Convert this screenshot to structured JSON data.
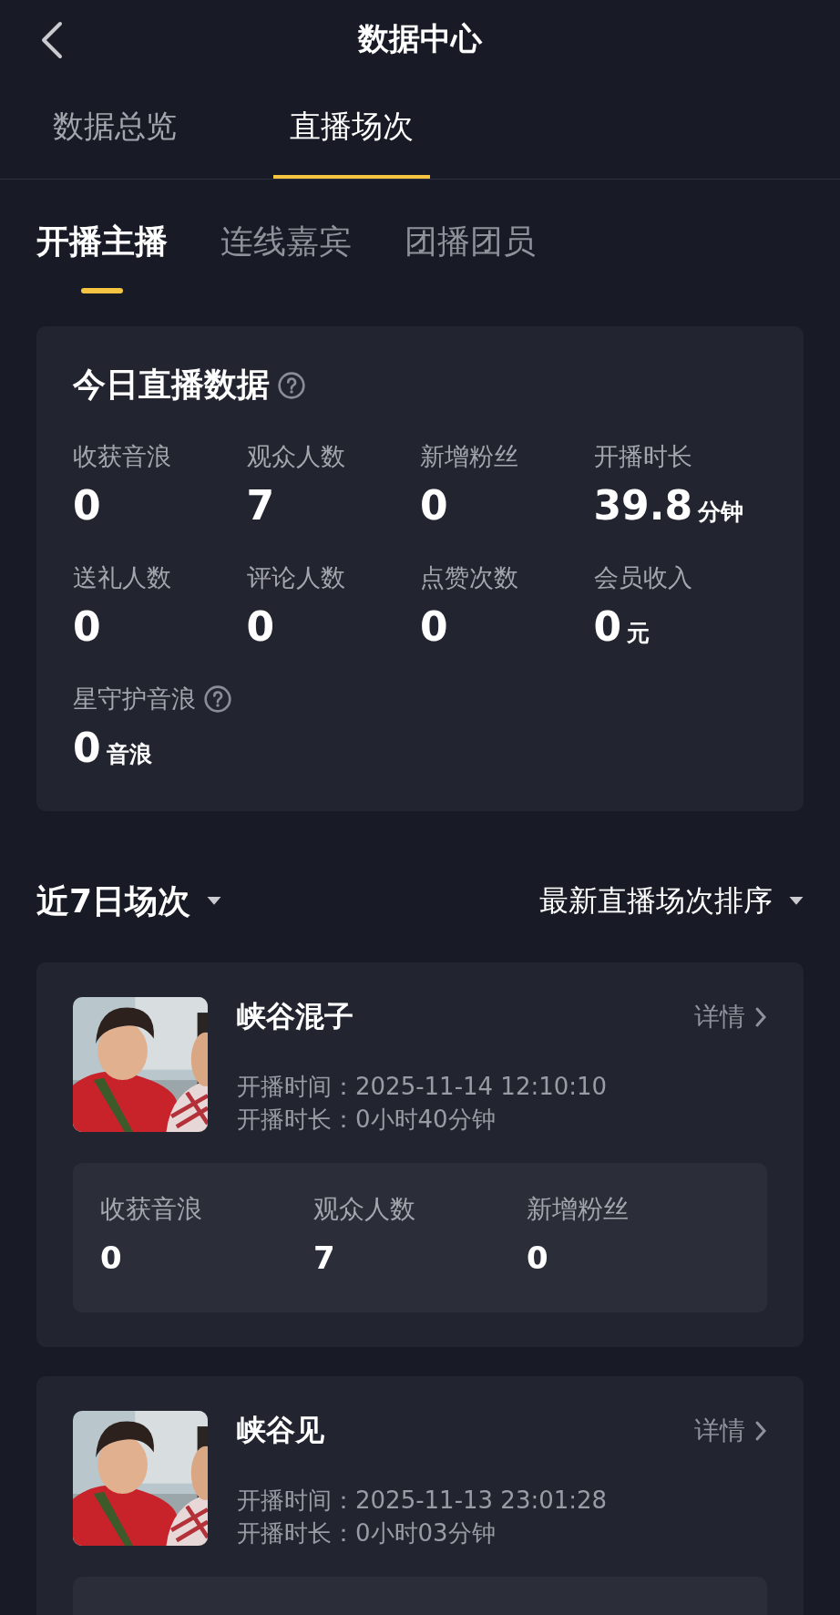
{
  "header": {
    "title": "数据中心"
  },
  "tabs": [
    {
      "label": "数据总览",
      "selected": false
    },
    {
      "label": "直播场次",
      "selected": true
    }
  ],
  "sub_tabs": [
    {
      "label": "开播主播",
      "selected": true
    },
    {
      "label": "连线嘉宾",
      "selected": false
    },
    {
      "label": "团播团员",
      "selected": false
    }
  ],
  "today": {
    "title": "今日直播数据",
    "help": true,
    "stats": [
      {
        "label": "收获音浪",
        "value": "0",
        "help": false
      },
      {
        "label": "观众人数",
        "value": "7",
        "help": false
      },
      {
        "label": "新增粉丝",
        "value": "0",
        "help": false
      },
      {
        "label": "开播时长",
        "value": "39.8",
        "unit": "分钟",
        "help": false
      },
      {
        "label": "送礼人数",
        "value": "0",
        "help": false
      },
      {
        "label": "评论人数",
        "value": "0",
        "help": false
      },
      {
        "label": "点赞次数",
        "value": "0",
        "help": false
      },
      {
        "label": "会员收入",
        "value": "0",
        "unit": "元",
        "help": false
      },
      {
        "label": "星守护音浪",
        "value": "0",
        "unit": "音浪",
        "help": true
      }
    ]
  },
  "sessions_header": {
    "range": "近7日场次",
    "sort": "最新直播场次排序"
  },
  "sessions": [
    {
      "title": "峡谷混子",
      "detail": "详情",
      "start": "开播时间：2025-11-14 12:10:10",
      "duration": "开播时长：0小时40分钟",
      "stats": [
        {
          "label": "收获音浪",
          "value": "0"
        },
        {
          "label": "观众人数",
          "value": "7"
        },
        {
          "label": "新增粉丝",
          "value": "0"
        }
      ]
    },
    {
      "title": "峡谷见",
      "detail": "详情",
      "start": "开播时间：2025-11-13 23:01:28",
      "duration": "开播时长：0小时03分钟"
    }
  ]
}
